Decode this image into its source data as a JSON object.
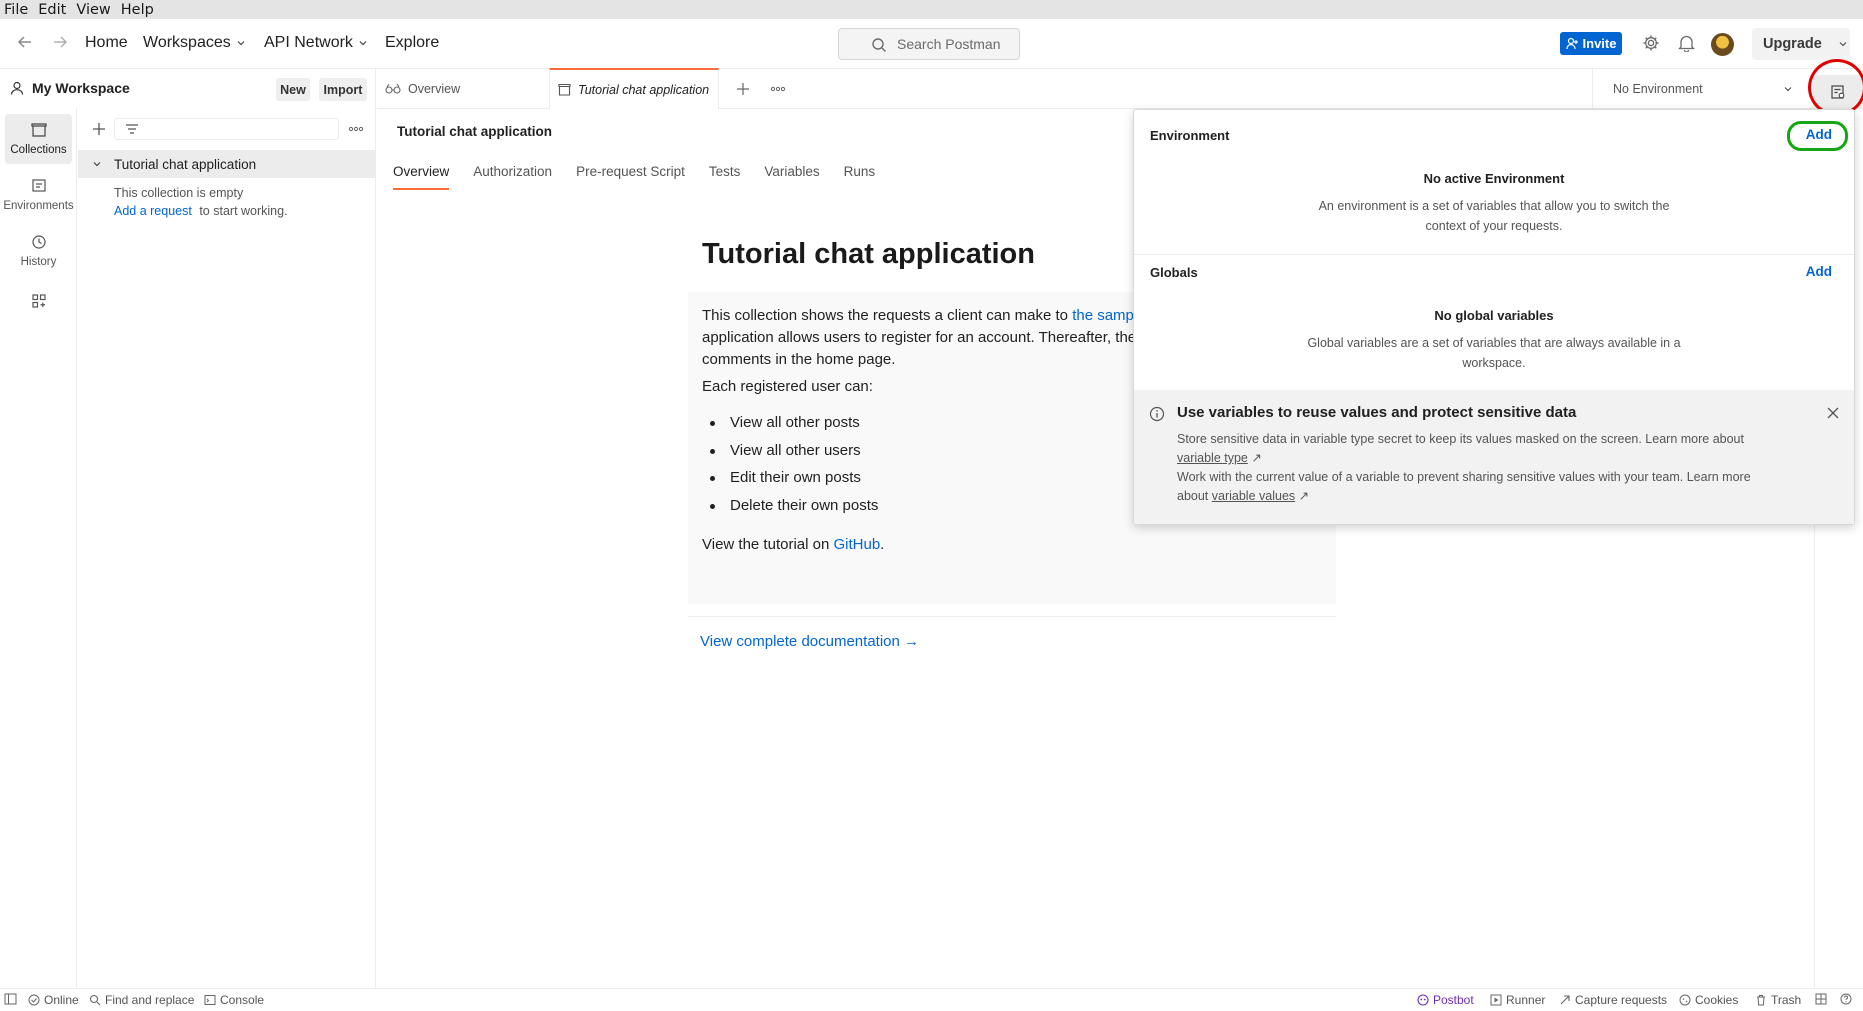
{
  "menubar": [
    "File",
    "Edit",
    "View",
    "Help"
  ],
  "header": {
    "nav": {
      "home": "Home",
      "workspaces": "Workspaces",
      "api_network": "API Network",
      "explore": "Explore"
    },
    "search_placeholder": "Search Postman",
    "invite": "Invite",
    "upgrade": "Upgrade"
  },
  "workspace": {
    "title": "My Workspace",
    "new": "New",
    "import": "Import"
  },
  "iconnav": {
    "collections": "Collections",
    "environments": "Environments",
    "history": "History"
  },
  "sidebar": {
    "collection_name": "Tutorial chat application",
    "empty_text": "This collection is empty",
    "add_request": "Add a request",
    "to_start": "to start working."
  },
  "tabs": {
    "overview": "Overview",
    "active": "Tutorial chat application"
  },
  "environment_select": "No Environment",
  "main": {
    "title": "Tutorial chat application",
    "subtabs": [
      "Overview",
      "Authorization",
      "Pre-request Script",
      "Tests",
      "Variables",
      "Runs"
    ]
  },
  "doc": {
    "heading": "Tutorial chat application",
    "p1_start": "This collection shows the requests a client can make to ",
    "p1_link": "the samp",
    "p1_line2": "application allows users to register for an account. Thereafter, the",
    "p1_line3": "comments in the home page.",
    "p2": "Each registered user can:",
    "bullets": [
      "View all other posts",
      "View all other users",
      "Edit their own posts",
      "Delete their own posts"
    ],
    "p3_start": "View the tutorial on ",
    "p3_link": "GitHub",
    "p3_end": ".",
    "view_docs": "View complete documentation →"
  },
  "popover": {
    "env_title": "Environment",
    "env_add": "Add",
    "no_env_title": "No active Environment",
    "no_env_desc_1": "An environment is a set of variables that allow you to switch the",
    "no_env_desc_2": "context of your requests.",
    "globals_title": "Globals",
    "globals_add": "Add",
    "no_glob_title": "No global variables",
    "no_glob_desc_1": "Global variables are a set of variables that are always available in a",
    "no_glob_desc_2": "workspace.",
    "banner_title": "Use variables to reuse values and protect sensitive data",
    "banner_l1": "Store sensitive data in variable type secret to keep its values masked on the screen. Learn more about",
    "banner_link1": "variable type",
    "banner_l2": "Work with the current value of a variable to prevent sharing sensitive values with your team. Learn more",
    "banner_l3": "about",
    "banner_link2": "variable values",
    "arrow": "↗"
  },
  "statusbar": {
    "online": "Online",
    "find_replace": "Find and replace",
    "console": "Console",
    "postbot": "Postbot",
    "runner": "Runner",
    "capture": "Capture requests",
    "cookies": "Cookies",
    "trash": "Trash"
  },
  "colors": {
    "accent": "#ff6c37",
    "brand_blue": "#0265d2",
    "highlight_red": "#e10000",
    "highlight_green": "#15a515"
  }
}
